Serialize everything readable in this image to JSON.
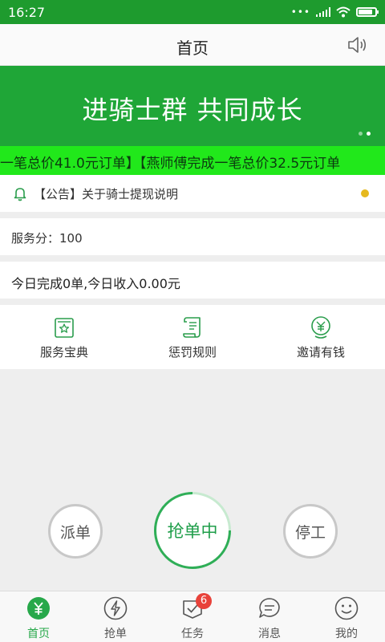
{
  "status_bar": {
    "time": "16:27"
  },
  "header": {
    "title": "首页"
  },
  "banner": {
    "slogan": "进骑士群 共同成长",
    "slide_index": 1,
    "slide_count": 2
  },
  "marquee": {
    "text": "ⅈ一笔总价41.0元订单】【燕师傅完成一笔总价32.5元订单"
  },
  "notice": {
    "text": "【公告】关于骑士提现说明"
  },
  "score": {
    "text": "服务分：100"
  },
  "today": {
    "text": "今日完成0单,今日收入0.00元"
  },
  "shortcuts": [
    {
      "label": "服务宝典",
      "icon": "book-star-icon"
    },
    {
      "label": "惩罚规则",
      "icon": "scroll-rules-icon"
    },
    {
      "label": "邀请有钱",
      "icon": "yen-badge-icon"
    }
  ],
  "actions": {
    "dispatch": "派单",
    "grab": "抢单中",
    "stop": "停工"
  },
  "tabs": [
    {
      "label": "首页",
      "icon": "yen-icon",
      "active": true
    },
    {
      "label": "抢单",
      "icon": "lightning-icon"
    },
    {
      "label": "任务",
      "icon": "task-check-icon",
      "badge": "6"
    },
    {
      "label": "消息",
      "icon": "message-icon"
    },
    {
      "label": "我的",
      "icon": "smiley-icon"
    }
  ],
  "colors": {
    "primary": "#1fa637",
    "accent_green": "#27a84a",
    "marquee_bg": "#21e81b",
    "badge_red": "#e8423a",
    "notice_dot": "#e6b91f"
  }
}
